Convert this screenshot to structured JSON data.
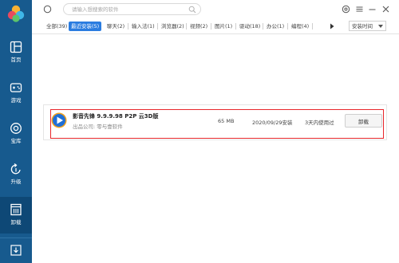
{
  "sidebar": {
    "items": [
      {
        "label": "首页",
        "icon": "home-icon"
      },
      {
        "label": "游戏",
        "icon": "gamepad-icon"
      },
      {
        "label": "宝库",
        "icon": "treasure-icon"
      },
      {
        "label": "升级",
        "icon": "upgrade-icon"
      },
      {
        "label": "卸载",
        "icon": "uninstall-icon",
        "active": true
      }
    ],
    "bottom_icon": "download-icon"
  },
  "topbar": {
    "search_placeholder": "请输入想搜索的软件",
    "controls": [
      "settings-icon",
      "menu-icon",
      "minimize-icon",
      "close-icon"
    ]
  },
  "tabs": [
    {
      "label": "全部(39)"
    },
    {
      "label": "最近安装(5)",
      "active": true
    },
    {
      "label": "聊天(2)"
    },
    {
      "label": "输入法(1)"
    },
    {
      "label": "浏览器(2)"
    },
    {
      "label": "视频(2)"
    },
    {
      "label": "图片(1)"
    },
    {
      "label": "驱动(18)"
    },
    {
      "label": "办公(1)"
    },
    {
      "label": "编程(4)"
    }
  ],
  "sort": {
    "label": "安装时间"
  },
  "apps": [
    {
      "name": "影音先锋 9.9.9.98 P2P 云3D版",
      "company": "出品公司: 零与壹软件",
      "size": "65 MB",
      "date": "2020/09/29安装",
      "usage": "3天内使用过",
      "button": "卸载"
    }
  ],
  "colors": {
    "sidebar": "#175a8e",
    "sidebar_active": "#0e4876",
    "tab_active": "#2a7ce0",
    "highlight": "#e8262b"
  }
}
